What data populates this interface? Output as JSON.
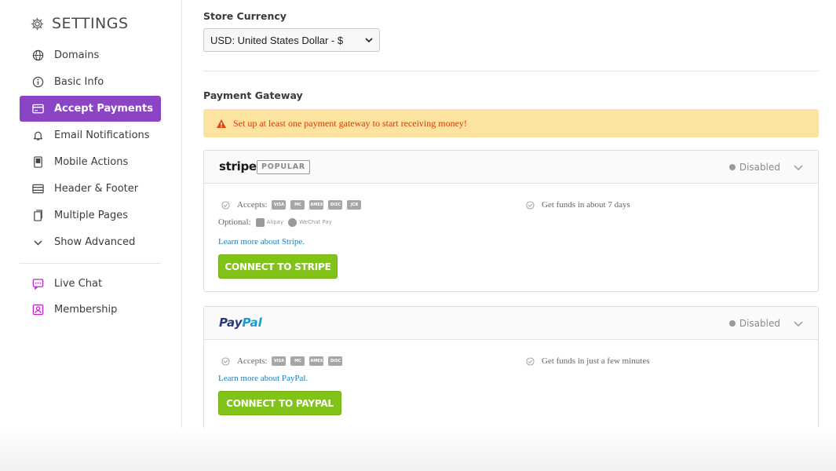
{
  "sidebar": {
    "title": "SETTINGS",
    "items": [
      {
        "label": "Domains",
        "icon": "globe-icon"
      },
      {
        "label": "Basic Info",
        "icon": "info-icon"
      },
      {
        "label": "Accept Payments",
        "icon": "credit-card-icon",
        "active": true
      },
      {
        "label": "Email Notifications",
        "icon": "bell-icon"
      },
      {
        "label": "Mobile Actions",
        "icon": "mobile-icon"
      },
      {
        "label": "Header & Footer",
        "icon": "header-footer-icon"
      },
      {
        "label": "Multiple Pages",
        "icon": "pages-icon"
      },
      {
        "label": "Show Advanced",
        "icon": "chevron-down-icon"
      }
    ],
    "extras": [
      {
        "label": "Live Chat",
        "icon": "chat-icon"
      },
      {
        "label": "Membership",
        "icon": "member-icon"
      }
    ]
  },
  "currency": {
    "label": "Store Currency",
    "selected": "USD: United States Dollar - $"
  },
  "gateway": {
    "label": "Payment Gateway",
    "warning": "Set up at least one payment gateway to start receiving money!"
  },
  "stripe": {
    "brand": "stripe",
    "badge": "POPULAR",
    "status": "Disabled",
    "accepts_label": "Accepts:",
    "cards": [
      "VISA",
      "MC",
      "AMEX",
      "DISC",
      "JCB"
    ],
    "optional_label": "Optional:",
    "optional": [
      "Alipay",
      "WeChat Pay"
    ],
    "funds": "Get funds in about 7 days",
    "learn_more": "Learn more about Stripe.",
    "button": "CONNECT TO STRIPE"
  },
  "paypal": {
    "brand_a": "Pay",
    "brand_b": "Pal",
    "status": "Disabled",
    "accepts_label": "Accepts:",
    "cards": [
      "VISA",
      "MC",
      "AMEX",
      "DISC"
    ],
    "funds": "Get funds in just a few minutes",
    "learn_more": "Learn more about PayPal.",
    "button": "CONNECT TO PAYPAL"
  },
  "colors": {
    "accent": "#8b44c4",
    "connect_button": "#82c31a",
    "warning_bg": "#fde3a0",
    "warning_text": "#d23c00",
    "link": "#1a7fc2"
  }
}
